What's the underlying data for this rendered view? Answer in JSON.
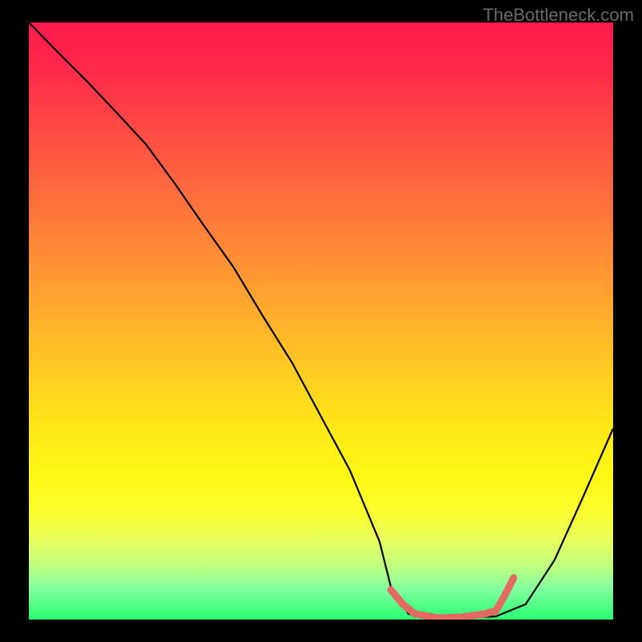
{
  "watermark": "TheBottleneck.com",
  "chart_data": {
    "type": "line",
    "title": "",
    "xlabel": "",
    "ylabel": "",
    "xlim": [
      0,
      100
    ],
    "ylim": [
      0,
      100
    ],
    "grid": false,
    "legend": false,
    "background": "vertical rainbow gradient (red top → green bottom)",
    "series": [
      {
        "name": "performance-curve",
        "stroke": "#000000",
        "x": [
          0,
          5,
          10,
          15,
          20,
          25,
          30,
          35,
          40,
          45,
          50,
          55,
          60,
          62,
          65,
          70,
          75,
          80,
          85,
          90,
          95,
          100
        ],
        "values": [
          100,
          95,
          90,
          85,
          79.5,
          73,
          66,
          59,
          51,
          43,
          34,
          25,
          13,
          5.5,
          1,
          0,
          0.2,
          0.6,
          2.5,
          10,
          21,
          32
        ]
      },
      {
        "name": "optimum-marker",
        "stroke": "#e26a62",
        "stroke_width": 8,
        "x": [
          62,
          64,
          66,
          70,
          74,
          78,
          80,
          81.5,
          83
        ],
        "values": [
          5,
          2.5,
          1,
          0.3,
          0.4,
          1,
          1.5,
          4,
          7
        ]
      }
    ],
    "colors": {
      "gradient_stops": [
        "#ff1a4d",
        "#ff6a3e",
        "#ffca22",
        "#fff815",
        "#2aff70"
      ],
      "curve": "#000000",
      "marker": "#e26a62",
      "frame": "#000000"
    },
    "notes": "Black V-shaped curve descending from top-left, reaching a flat minimum around x≈65–80 highlighted by a thick salmon-pink segment, then rising toward the right edge. Chart is framed by a black border; no axes, ticks, or numeric labels are rendered."
  }
}
